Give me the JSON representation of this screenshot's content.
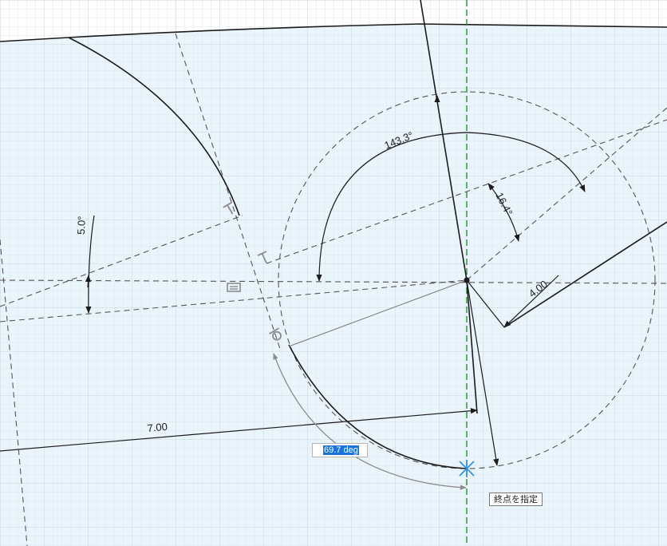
{
  "colors": {
    "sketch_plane_fill": "#eaf4fb",
    "grid_minor": "#dfe8ef",
    "grid_major": "#c7d4de",
    "sketch_line": "#1c1c1c",
    "construction_line": "#555555",
    "axis_green": "#2e8b3a",
    "cursor_blue": "#2b8fe0",
    "input_highlight": "#1a73d9",
    "sweep_gray": "#8c8c8c"
  },
  "dimensions": {
    "angle_143": "143.3°",
    "angle_16": "16.4°",
    "angle_5": "5.0°",
    "radius_4": "4.00",
    "length_7": "7.00"
  },
  "angle_input": {
    "value": "69.7 deg"
  },
  "tooltip": {
    "text": "終点を指定"
  },
  "icons": {
    "perpendicular": "perpendicular-constraint-icon",
    "parallel": "parallel-constraint-icon",
    "tangent": "tangent-constraint-icon",
    "cursor": "cursor-crosshair-icon"
  }
}
